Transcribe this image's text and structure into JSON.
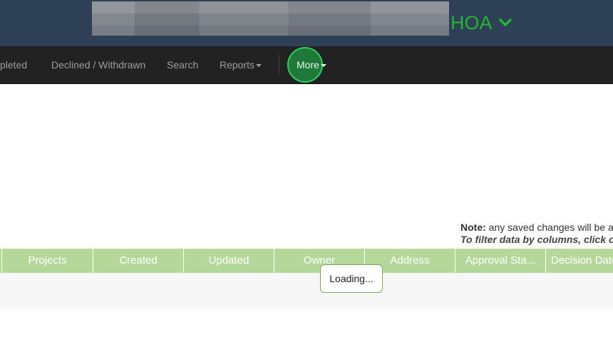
{
  "header": {
    "org_suffix": "HOA",
    "org_chevron_icon": "chevron-down-icon",
    "accent_color": "#22b531"
  },
  "nav": {
    "items": [
      {
        "label": "pleted"
      },
      {
        "label": "Declined / Withdrawn"
      },
      {
        "label": "Search"
      },
      {
        "label": "Reports"
      },
      {
        "label": "More"
      }
    ]
  },
  "note": {
    "label": "Note:",
    "text": "any saved changes will be a",
    "filter_hint": "To filter data by columns, click o"
  },
  "table": {
    "columns": [
      "Projects",
      "Created",
      "Updated",
      "Owner",
      "Address",
      "Approval Sta...",
      "Decision Date"
    ],
    "header_color": "#b5d89a"
  },
  "loading_text": "Loading..."
}
